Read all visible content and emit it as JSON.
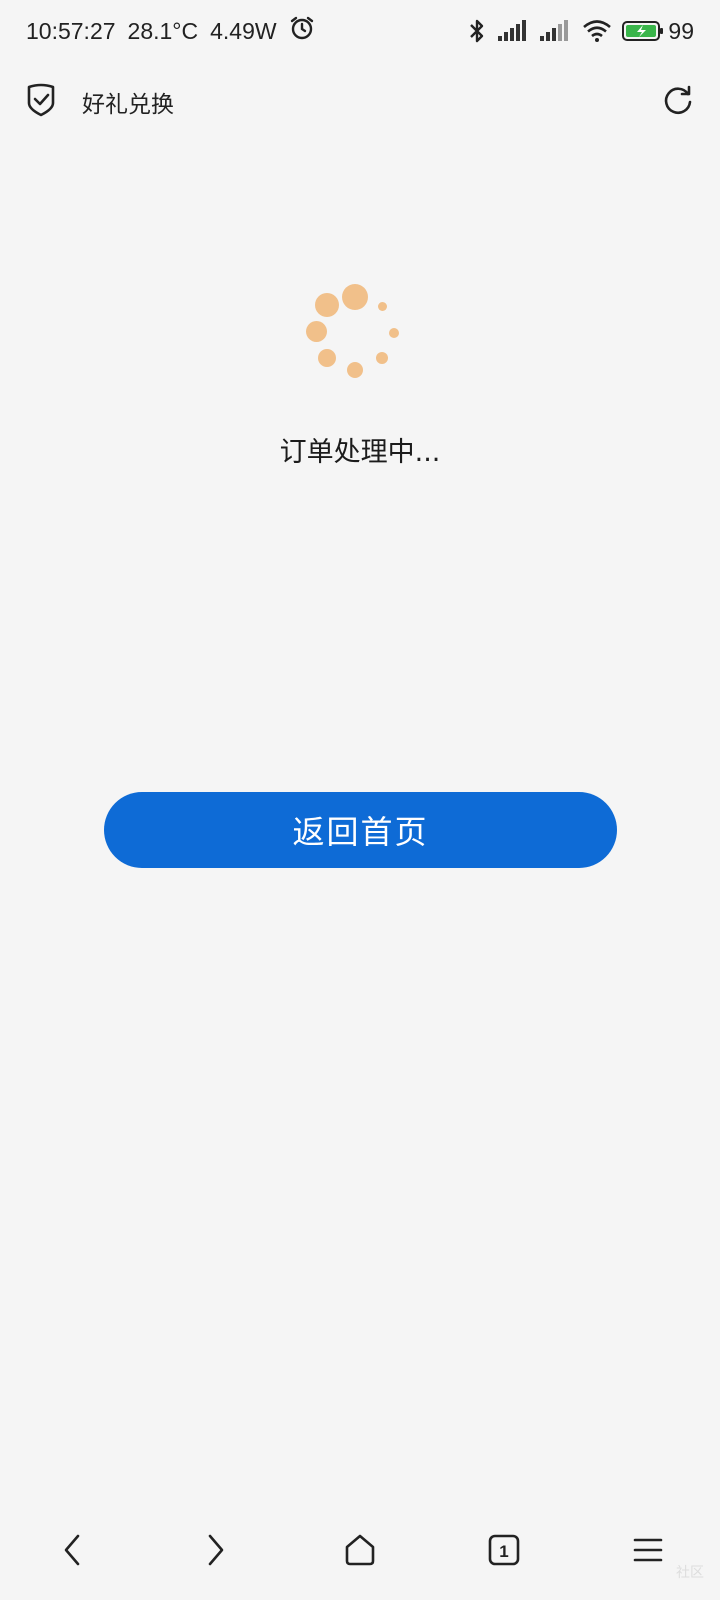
{
  "status_bar": {
    "time": "10:57:27",
    "temperature": "28.1°C",
    "power": "4.49W",
    "battery": "99"
  },
  "header": {
    "title": "好礼兑换"
  },
  "main": {
    "status_text": "订单处理中...",
    "home_button_label": "返回首页"
  },
  "watermark": "社区",
  "colors": {
    "accent": "#0e6bd6",
    "spinner": "#f1c08a",
    "background": "#f5f5f5"
  },
  "icons": {
    "header_left": "shield-check-icon",
    "header_right": "refresh-icon",
    "nav": [
      "back-icon",
      "forward-icon",
      "home-icon",
      "tabs-icon",
      "menu-icon"
    ]
  }
}
